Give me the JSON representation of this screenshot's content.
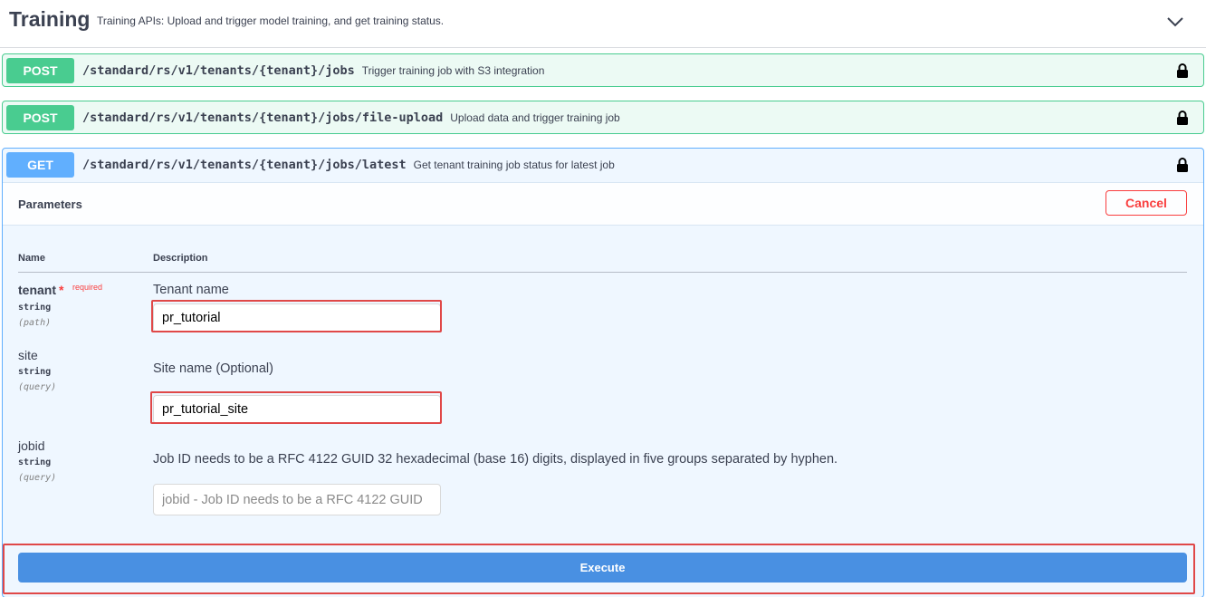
{
  "tag": {
    "title": "Training",
    "description": "Training APIs: Upload and trigger model training, and get training status."
  },
  "operations": [
    {
      "method": "POST",
      "path": "/standard/rs/v1/tenants/{tenant}/jobs",
      "summary": "Trigger training job with S3 integration"
    },
    {
      "method": "POST",
      "path": "/standard/rs/v1/tenants/{tenant}/jobs/file-upload",
      "summary": "Upload data and trigger training job"
    },
    {
      "method": "GET",
      "path": "/standard/rs/v1/tenants/{tenant}/jobs/latest",
      "summary": "Get tenant training job status for latest job"
    }
  ],
  "parameters_section": {
    "title": "Parameters",
    "cancel_label": "Cancel",
    "col_name": "Name",
    "col_description": "Description",
    "params": [
      {
        "name": "tenant",
        "required_marker": "*",
        "required_label": "required",
        "type": "string",
        "in": "(path)",
        "description": "Tenant name",
        "value": "pr_tutorial",
        "placeholder": ""
      },
      {
        "name": "site",
        "type": "string",
        "in": "(query)",
        "description": "Site name (Optional)",
        "value": "pr_tutorial_site",
        "placeholder": ""
      },
      {
        "name": "jobid",
        "type": "string",
        "in": "(query)",
        "description": "Job ID needs to be a RFC 4122 GUID 32 hexadecimal (base 16) digits, displayed in five groups separated by hyphen.",
        "value": "",
        "placeholder": "jobid - Job ID needs to be a RFC 4122 GUID"
      }
    ],
    "execute_label": "Execute"
  },
  "colors": {
    "post": "#49cc90",
    "get": "#61affe",
    "execute": "#4990e2",
    "cancel": "#f93e3e",
    "highlight": "#e04848"
  },
  "icons": {
    "collapse": "chevron-down-icon",
    "auth": "lock-icon"
  }
}
